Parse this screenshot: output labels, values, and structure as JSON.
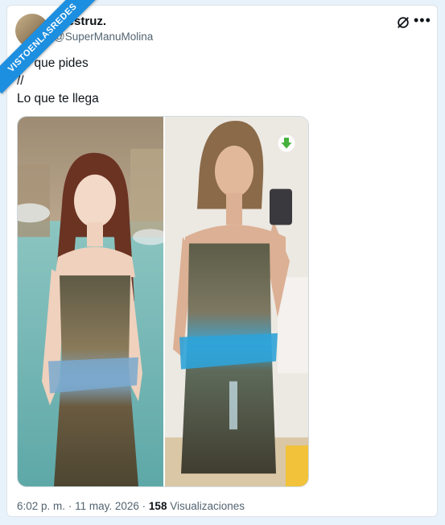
{
  "watermark": {
    "text": "VISTOENLASREDES"
  },
  "author": {
    "display_name": "avestruz.",
    "handle": "@SuperManuMolina"
  },
  "header_icons": [
    "grok-icon",
    "more-icon"
  ],
  "tweet": {
    "lines": [
      "Lo que pides",
      "//",
      "Lo que te llega"
    ]
  },
  "media": {
    "left_photo": "woman in landscape-print strapless dress at fountain",
    "right_photo": "woman taking mirror selfie in same dress",
    "download_icon": "green-download-arrow"
  },
  "meta": {
    "time": "6:02 p. m.",
    "separator": "·",
    "date": "11 may. 2026",
    "views_count": "158",
    "views_label": "Visualizaciones"
  },
  "colors": {
    "accent": "#1d8fe0",
    "text_primary": "#0f1419",
    "text_secondary": "#536471",
    "page_bg": "#e8f2fb"
  }
}
